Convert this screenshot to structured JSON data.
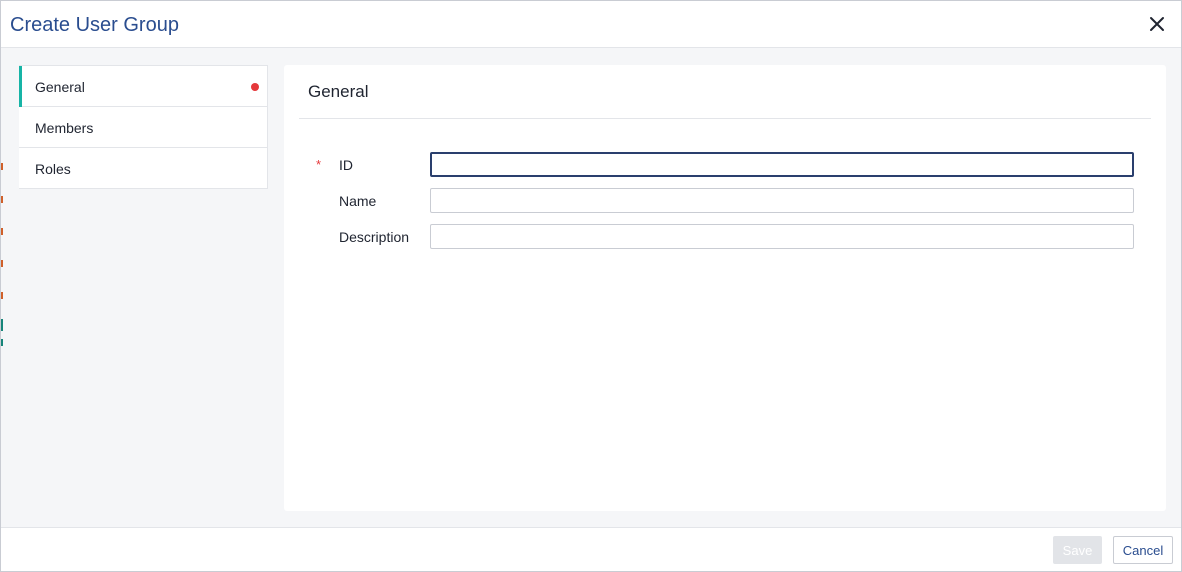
{
  "dialog": {
    "title": "Create User Group",
    "close_icon": "close-icon"
  },
  "nav": {
    "items": [
      {
        "label": "General",
        "active": true,
        "error_dot": true
      },
      {
        "label": "Members",
        "active": false,
        "error_dot": false
      },
      {
        "label": "Roles",
        "active": false,
        "error_dot": false
      }
    ]
  },
  "general": {
    "title": "General",
    "required_marker": "*",
    "fields": {
      "id": {
        "label": "ID",
        "value": "",
        "required": true
      },
      "name": {
        "label": "Name",
        "value": ""
      },
      "description": {
        "label": "Description",
        "value": ""
      }
    }
  },
  "footer": {
    "save_label": "Save",
    "cancel_label": "Cancel"
  },
  "colors": {
    "title": "#2a4d8f",
    "accent": "#17b4a6",
    "error": "#e5383b",
    "save_disabled": "#e2e4e8"
  }
}
